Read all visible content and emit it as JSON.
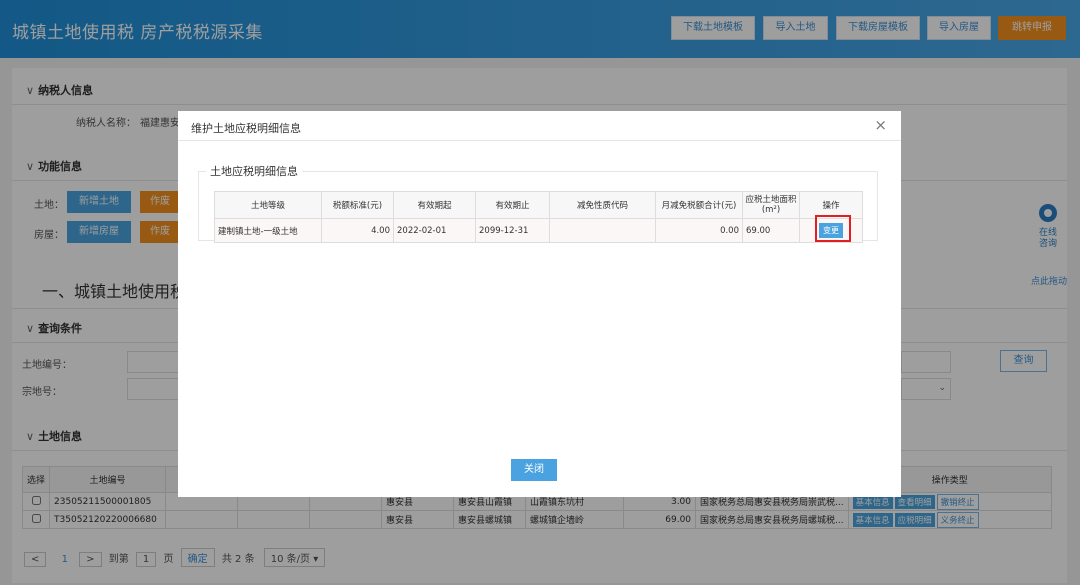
{
  "header": {
    "title": "城镇土地使用税 房产税税源采集",
    "buttons": [
      "下载土地模板",
      "导入土地",
      "下载房屋模板",
      "导入房屋",
      "跳转申报"
    ]
  },
  "taxpayer": {
    "section": "纳税人信息",
    "name_label": "纳税人名称：",
    "name_value": "福建惠安"
  },
  "function": {
    "section": "功能信息",
    "land_label": "土地：",
    "house_label": "房屋：",
    "add_land": "新增土地",
    "add_house": "新增房屋",
    "void": "作废"
  },
  "section_title": "一、城镇土地使用税",
  "query": {
    "section": "查询条件",
    "land_no_label": "土地编号：",
    "parcel_no_label": "宗地号：",
    "button": "查询"
  },
  "land_info": {
    "section": "土地信息",
    "headers": [
      "选择",
      "土地编号",
      "操作类型"
    ],
    "rows": [
      {
        "no": "23505211500001805",
        "county": "惠安县",
        "town": "惠安县山霞镇",
        "addr": "山霞镇东坑村",
        "amount": "3.00",
        "authority": "国家税务总局惠安县税务局崇武税...",
        "actions": [
          "基本信息",
          "查看明细",
          "撤销终止"
        ]
      },
      {
        "no": "T35052120220006680",
        "county": "惠安县",
        "town": "惠安县螺城镇",
        "addr": "螺城镇企墙岭",
        "amount": "69.00",
        "authority": "国家税务总局惠安县税务局螺城税...",
        "actions": [
          "基本信息",
          "应税明细",
          "义务终止"
        ]
      }
    ]
  },
  "pager": {
    "prev": "<",
    "page": "1",
    "next": ">",
    "goto": "到第",
    "page_unit": "页",
    "confirm": "确定",
    "total": "共 2 条",
    "page_size": "10 条/页 ▾"
  },
  "modal": {
    "title": "维护土地应税明细信息",
    "close_icon": "×",
    "legend": "土地应税明细信息",
    "headers": [
      "土地等级",
      "税额标准(元)",
      "有效期起",
      "有效期止",
      "减免性质代码",
      "月减免税额合计(元)",
      "应税土地面积(m²)",
      "操作"
    ],
    "row": [
      "建制镇土地-一级土地",
      "4.00",
      "2022-02-01",
      "2099-12-31",
      "",
      "0.00",
      "69.00"
    ],
    "change_btn": "变更",
    "close_btn": "关闭"
  },
  "side": {
    "label_1": "在线",
    "label_2": "咨询",
    "drag": "点此拖动"
  }
}
